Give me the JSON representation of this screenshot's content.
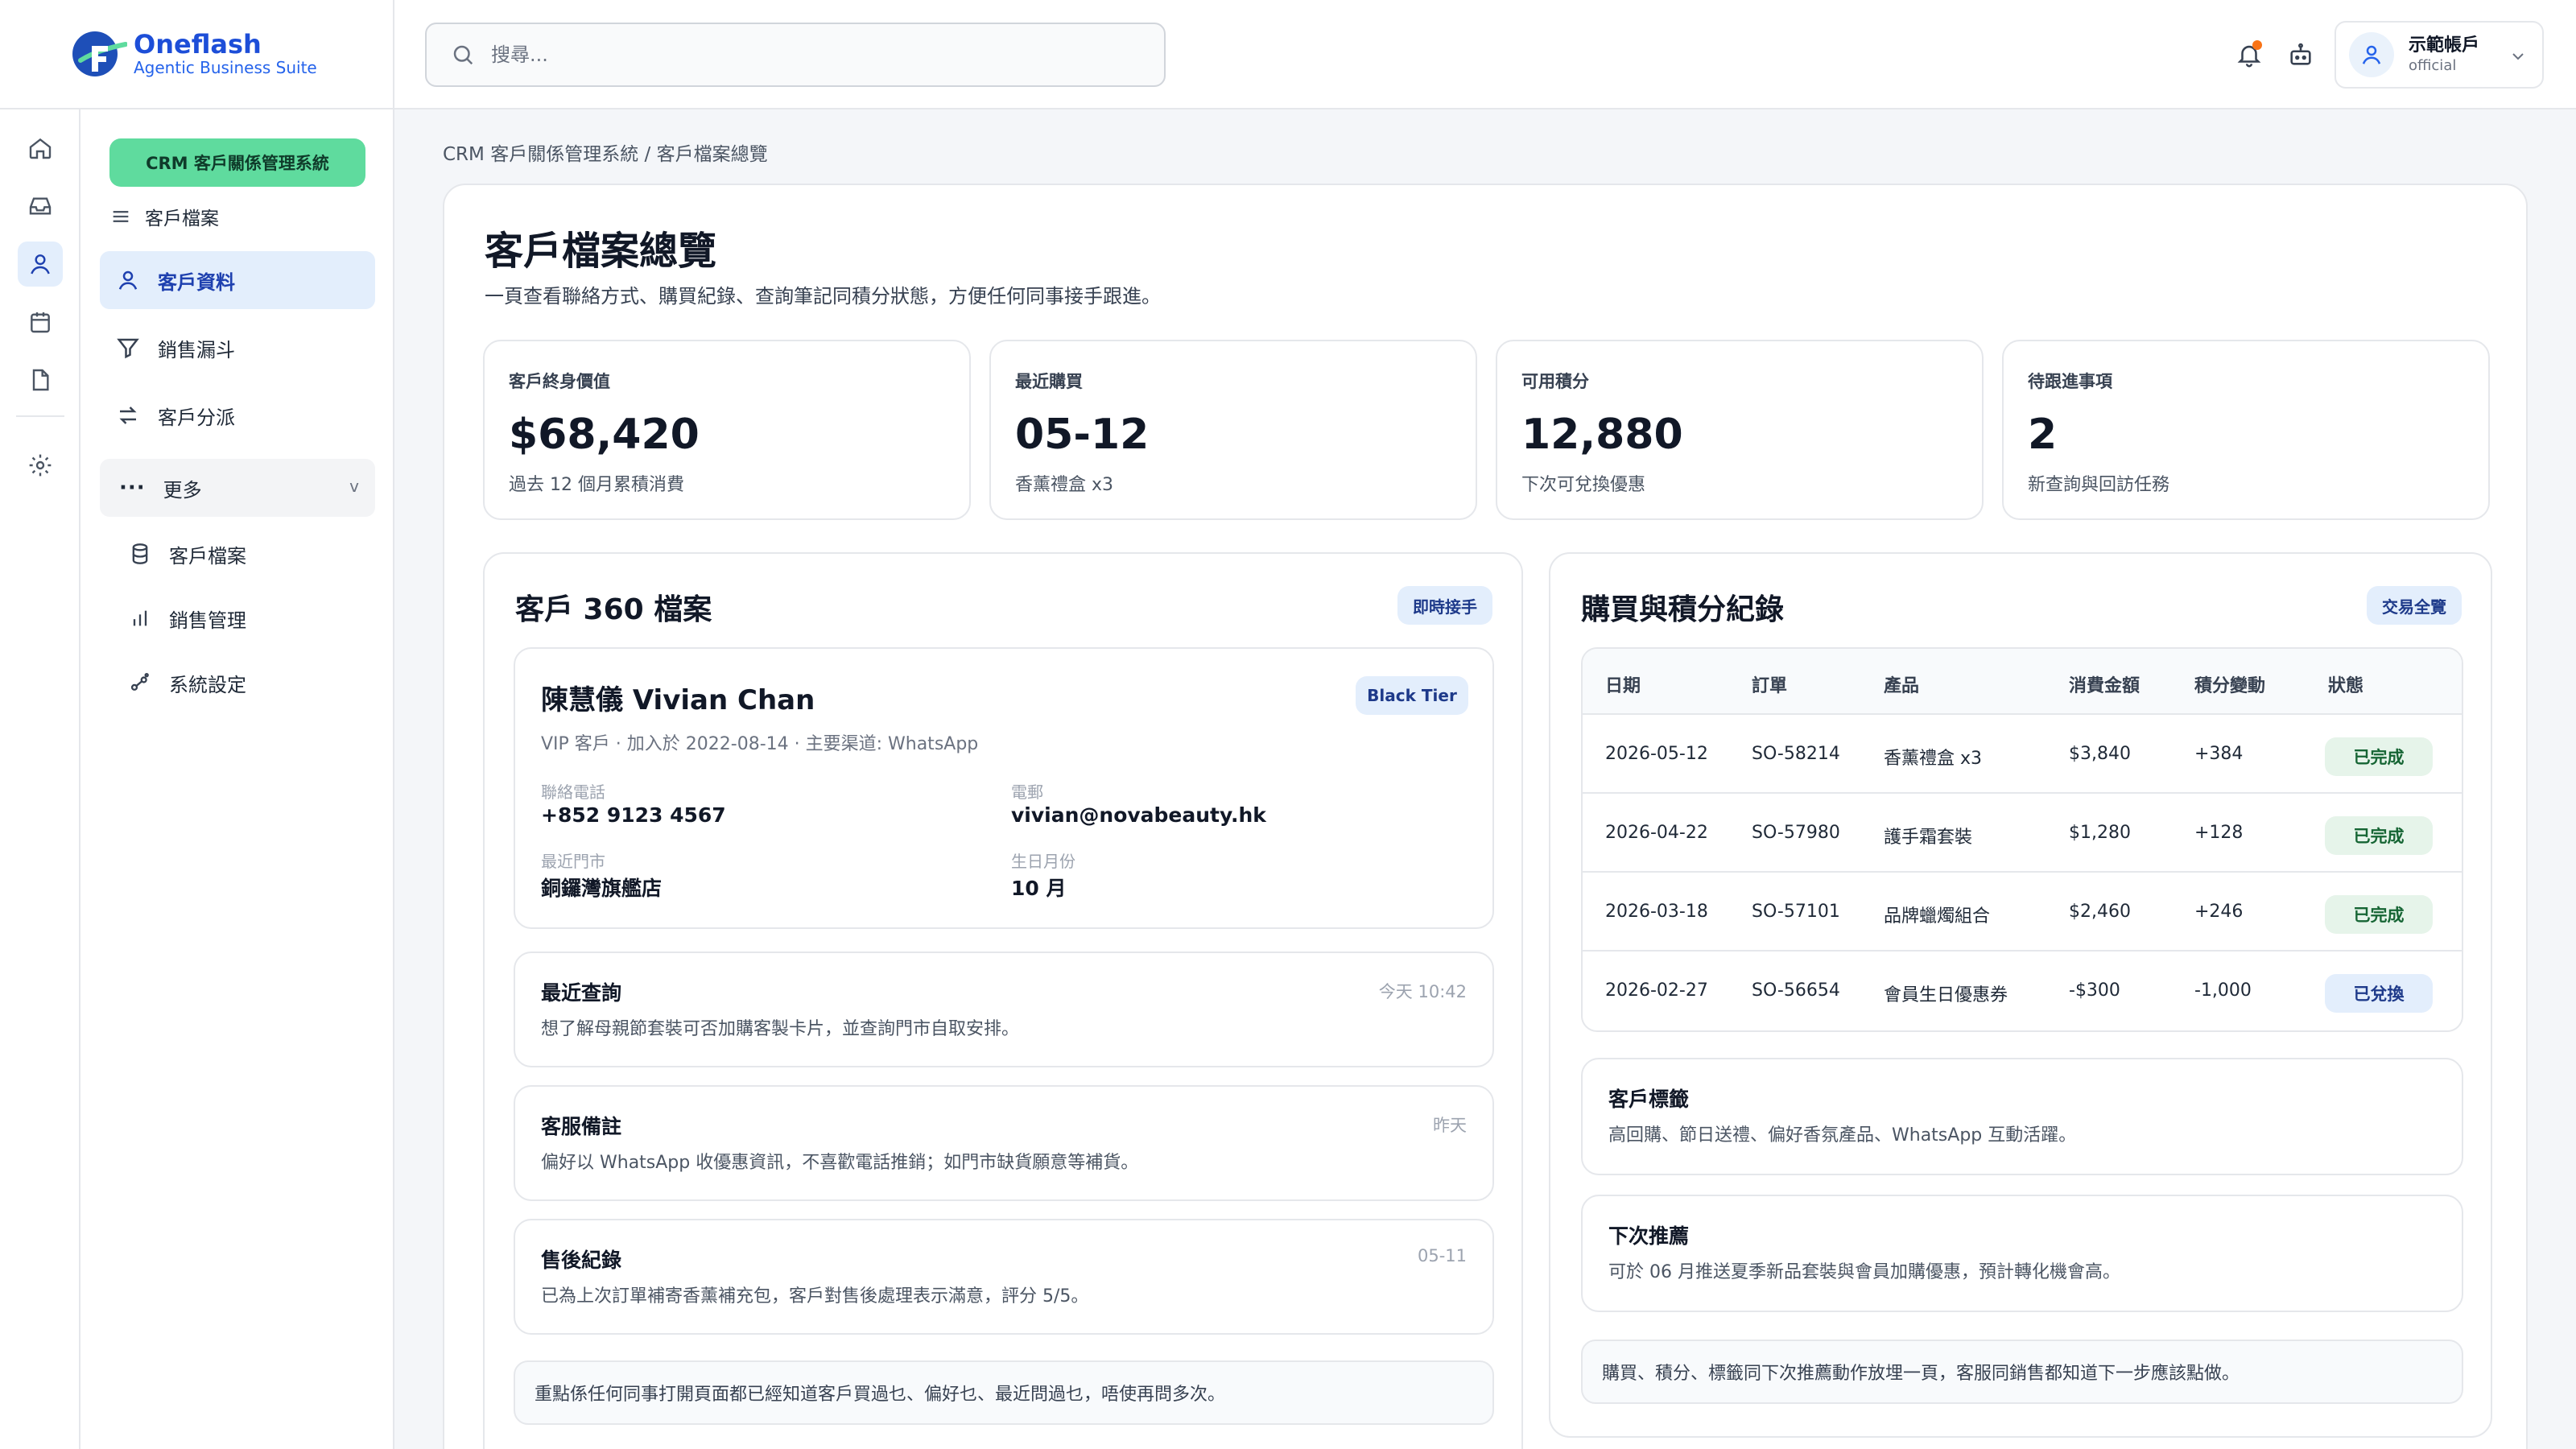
{
  "brand": {
    "name": "Oneflash",
    "tagline": "Agentic Business Suite",
    "primary_color": "#1d4ed8",
    "accent_color": "#5fdb9e"
  },
  "search": {
    "placeholder": "搜尋..."
  },
  "account": {
    "name": "示範帳戶",
    "sub": "official"
  },
  "rail": {
    "icons": [
      "home-icon",
      "inbox-icon",
      "user-icon",
      "calendar-icon",
      "document-icon",
      "gear-icon"
    ],
    "active": "user-icon"
  },
  "nav": {
    "module_badge": "CRM 客戶關係管理系統",
    "section": "客戶檔案",
    "items": [
      {
        "label": "客戶資料",
        "icon": "user-icon",
        "active": true
      },
      {
        "label": "銷售漏斗",
        "icon": "funnel-icon"
      },
      {
        "label": "客戶分派",
        "icon": "swap-icon"
      }
    ],
    "more_label": "更多",
    "more_chevron": "v",
    "sub_items": [
      {
        "label": "客戶檔案",
        "icon": "database-icon"
      },
      {
        "label": "銷售管理",
        "icon": "bar-chart-icon"
      },
      {
        "label": "系統設定",
        "icon": "settings-nodes-icon"
      }
    ]
  },
  "breadcrumb": "CRM 客戶關係管理系統 / 客戶檔案總覽",
  "page": {
    "title": "客戶檔案總覽",
    "subtitle": "一頁查看聯絡方式、購買紀錄、查詢筆記同積分狀態，方便任何同事接手跟進。"
  },
  "kpis": [
    {
      "label": "客戶終身價值",
      "value": "$68,420",
      "note": "過去 12 個月累積消費"
    },
    {
      "label": "最近購買",
      "value": "05-12",
      "note": "香薰禮盒 x3"
    },
    {
      "label": "可用積分",
      "value": "12,880",
      "note": "下次可兌換優惠"
    },
    {
      "label": "待跟進事項",
      "value": "2",
      "note": "新查詢與回訪任務"
    }
  ],
  "profile_card": {
    "title": "客戶 360 檔案",
    "badge": "即時接手",
    "customer": {
      "name": "陳慧儀 Vivian Chan",
      "tier": "Black Tier",
      "meta": "VIP 客戶 · 加入於 2022-08-14 · 主要渠道: WhatsApp",
      "phone_label": "聯絡電話",
      "phone": "+852 9123 4567",
      "email_label": "電郵",
      "email": "vivian@novabeauty.hk",
      "store_label": "最近門市",
      "store": "銅鑼灣旗艦店",
      "birthday_label": "生日月份",
      "birthday": "10 月"
    },
    "notes": [
      {
        "title": "最近查詢",
        "time": "今天 10:42",
        "body": "想了解母親節套裝可否加購客製卡片，並查詢門市自取安排。"
      },
      {
        "title": "客服備註",
        "time": "昨天",
        "body": "偏好以 WhatsApp 收優惠資訊，不喜歡電話推銷；如門市缺貨願意等補貨。"
      },
      {
        "title": "售後紀錄",
        "time": "05-11",
        "body": "已為上次訂單補寄香薰補充包，客戶對售後處理表示滿意，評分 5/5。"
      }
    ],
    "hint": "重點係任何同事打開頁面都已經知道客戶買過乜、偏好乜、最近問過乜，唔使再問多次。"
  },
  "purchase_card": {
    "title": "購買與積分紀錄",
    "badge": "交易全覽",
    "columns": [
      "日期",
      "訂單",
      "產品",
      "消費金額",
      "積分變動",
      "狀態"
    ],
    "rows": [
      {
        "date": "2026-05-12",
        "order": "SO-58214",
        "product": "香薰禮盒 x3",
        "amount": "$3,840",
        "points": "+384",
        "status": "已完成",
        "status_type": "done"
      },
      {
        "date": "2026-04-22",
        "order": "SO-57980",
        "product": "護手霜套裝",
        "amount": "$1,280",
        "points": "+128",
        "status": "已完成",
        "status_type": "done"
      },
      {
        "date": "2026-03-18",
        "order": "SO-57101",
        "product": "品牌蠟燭組合",
        "amount": "$2,460",
        "points": "+246",
        "status": "已完成",
        "status_type": "done"
      },
      {
        "date": "2026-02-27",
        "order": "SO-56654",
        "product": "會員生日優惠券",
        "amount": "-$300",
        "points": "-1,000",
        "status": "已兌換",
        "status_type": "redeem"
      }
    ],
    "tags_title": "客戶標籤",
    "tags_body": "高回購、節日送禮、偏好香氛產品、WhatsApp 互動活躍。",
    "next_title": "下次推薦",
    "next_body": "可於 06 月推送夏季新品套裝與會員加購優惠，預計轉化機會高。",
    "hint": "購買、積分、標籤同下次推薦動作放埋一頁，客服同銷售都知道下一步應該點做。"
  }
}
